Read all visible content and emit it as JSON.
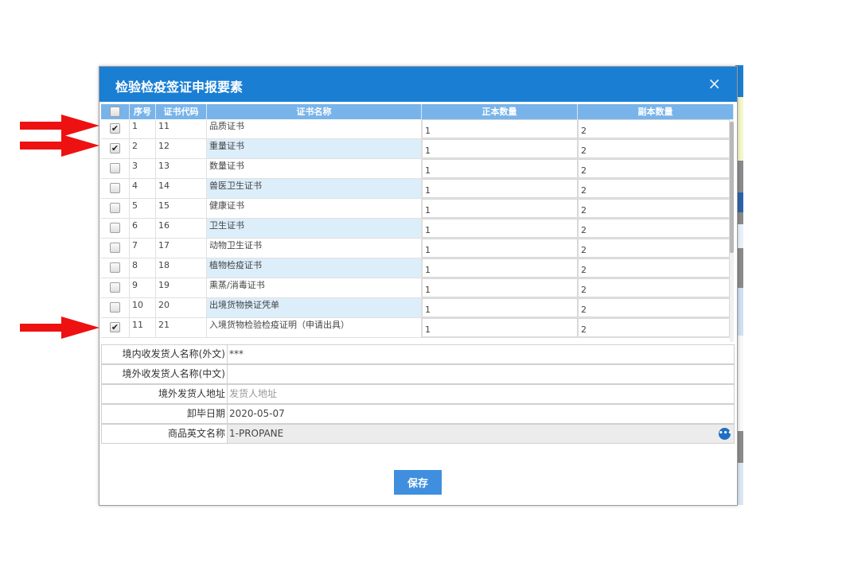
{
  "modal": {
    "title": "检验检疫签证申报要素",
    "close_glyph": "×"
  },
  "grid": {
    "columns": [
      "序号",
      "证书代码",
      "证书名称",
      "正本数量",
      "副本数量"
    ],
    "rows": [
      {
        "checked": true,
        "seq": "1",
        "code": "11",
        "name": "品质证书",
        "original": "1",
        "copy": "2"
      },
      {
        "checked": true,
        "seq": "2",
        "code": "12",
        "name": "重量证书",
        "original": "1",
        "copy": "2"
      },
      {
        "checked": false,
        "seq": "3",
        "code": "13",
        "name": "数量证书",
        "original": "1",
        "copy": "2"
      },
      {
        "checked": false,
        "seq": "4",
        "code": "14",
        "name": "兽医卫生证书",
        "original": "1",
        "copy": "2"
      },
      {
        "checked": false,
        "seq": "5",
        "code": "15",
        "name": "健康证书",
        "original": "1",
        "copy": "2"
      },
      {
        "checked": false,
        "seq": "6",
        "code": "16",
        "name": "卫生证书",
        "original": "1",
        "copy": "2"
      },
      {
        "checked": false,
        "seq": "7",
        "code": "17",
        "name": "动物卫生证书",
        "original": "1",
        "copy": "2"
      },
      {
        "checked": false,
        "seq": "8",
        "code": "18",
        "name": "植物检疫证书",
        "original": "1",
        "copy": "2"
      },
      {
        "checked": false,
        "seq": "9",
        "code": "19",
        "name": "熏蒸/消毒证书",
        "original": "1",
        "copy": "2"
      },
      {
        "checked": false,
        "seq": "10",
        "code": "20",
        "name": "出境货物换证凭单",
        "original": "1",
        "copy": "2"
      },
      {
        "checked": true,
        "seq": "11",
        "code": "21",
        "name": "入境货物检验检疫证明（申请出具）",
        "original": "1",
        "copy": "2"
      }
    ]
  },
  "form": {
    "fields": [
      {
        "label": "境内收发货人名称(外文)",
        "value": "***",
        "placeholder": ""
      },
      {
        "label": "境外收发货人名称(中文)",
        "value": "",
        "placeholder": ""
      },
      {
        "label": "境外发货人地址",
        "value": "",
        "placeholder": "发货人地址"
      },
      {
        "label": "卸毕日期",
        "value": "2020-05-07",
        "placeholder": ""
      },
      {
        "label": "商品英文名称",
        "value": "1-PROPANE",
        "placeholder": ""
      }
    ]
  },
  "save_label": "保存",
  "colors": {
    "titlebar": "#1a7fd3",
    "header": "#78b4ea",
    "arrow": "#ee1111",
    "save": "#3f8fde"
  }
}
